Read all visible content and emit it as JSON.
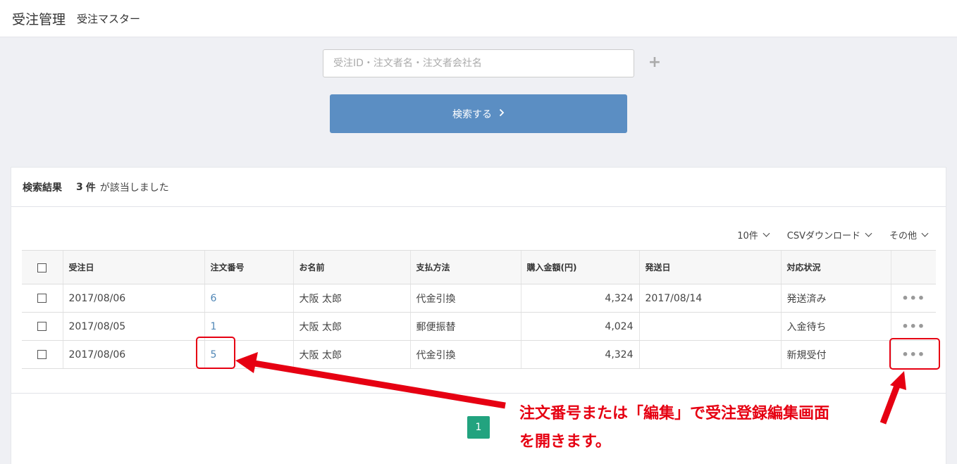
{
  "header": {
    "title": "受注管理",
    "subtitle": "受注マスター"
  },
  "search": {
    "placeholder": "受注ID・注文者名・注文者会社名",
    "button_label": "検索する"
  },
  "results": {
    "label": "検索結果",
    "count": "3",
    "unit": "件",
    "message": "が該当しました"
  },
  "toolbar": {
    "per_page": "10件",
    "csv": "CSVダウンロード",
    "other": "その他"
  },
  "table": {
    "headers": [
      "受注日",
      "注文番号",
      "お名前",
      "支払方法",
      "購入金額(円)",
      "発送日",
      "対応状況"
    ],
    "rows": [
      {
        "date": "2017/08/06",
        "order_no": "6",
        "name": "大阪 太郎",
        "payment": "代金引換",
        "amount": "4,324",
        "ship_date": "2017/08/14",
        "status": "発送済み",
        "more": "•••"
      },
      {
        "date": "2017/08/05",
        "order_no": "1",
        "name": "大阪 太郎",
        "payment": "郵便振替",
        "amount": "4,024",
        "ship_date": "",
        "status": "入金待ち",
        "more": "•••"
      },
      {
        "date": "2017/08/06",
        "order_no": "5",
        "name": "大阪 太郎",
        "payment": "代金引換",
        "amount": "4,324",
        "ship_date": "",
        "status": "新規受付",
        "more": "•••"
      }
    ]
  },
  "pagination": {
    "current": "1"
  },
  "annotation": {
    "line1": "注文番号または「編集」で受注登録編集画面",
    "line2": "を開きます。",
    "color": "#e60012"
  }
}
